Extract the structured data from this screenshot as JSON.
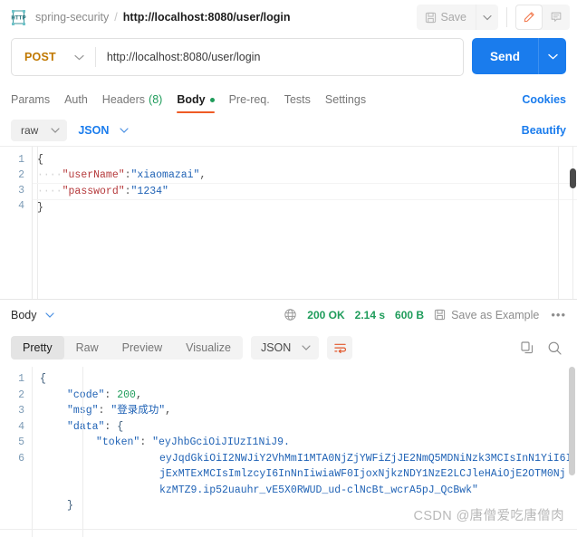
{
  "topbar": {
    "logo_icon": "http-logo-icon",
    "collection": "spring-security",
    "separator": "/",
    "request_name": "http://localhost:8080/user/login",
    "save_label": "Save",
    "save_icon": "floppy-disk-icon",
    "save_caret_icon": "chevron-down-icon",
    "edit_icon": "pencil-icon",
    "comment_icon": "comment-icon"
  },
  "request": {
    "method": "POST",
    "method_caret_icon": "chevron-down-icon",
    "url": "http://localhost:8080/user/login",
    "send_label": "Send",
    "send_caret_icon": "chevron-down-icon",
    "tabs": [
      {
        "label": "Params",
        "selected": false
      },
      {
        "label": "Auth",
        "selected": false
      },
      {
        "label": "Headers",
        "count": "(8)",
        "selected": false
      },
      {
        "label": "Body",
        "selected": true,
        "dot": true
      },
      {
        "label": "Pre-req.",
        "selected": false
      },
      {
        "label": "Tests",
        "selected": false
      },
      {
        "label": "Settings",
        "selected": false
      }
    ],
    "cookies_label": "Cookies",
    "body_mode": "raw",
    "body_mode_caret_icon": "chevron-down-icon",
    "body_format": "JSON",
    "body_format_caret_icon": "chevron-down-icon",
    "beautify_label": "Beautify",
    "body_lines": [
      {
        "n": "1",
        "open_brace": "{"
      },
      {
        "n": "2",
        "indent": "····",
        "key": "\"userName\"",
        "colon": ":",
        "value": "\"xiaomazai\"",
        "comma": ","
      },
      {
        "n": "3",
        "indent": "····",
        "key": "\"password\"",
        "colon": ":",
        "value": "\"1234\"",
        "comma": ""
      },
      {
        "n": "4",
        "close_brace": "}"
      }
    ]
  },
  "response": {
    "body_label": "Body",
    "body_caret_icon": "chevron-down-icon",
    "globe_icon": "globe-icon",
    "status_code": "200 OK",
    "time": "2.14 s",
    "size": "600 B",
    "save_example_icon": "floppy-disk-icon",
    "save_example_label": "Save as Example",
    "more_icon": "ellipsis-icon",
    "view_tabs": [
      {
        "label": "Pretty",
        "selected": true
      },
      {
        "label": "Raw",
        "selected": false
      },
      {
        "label": "Preview",
        "selected": false
      },
      {
        "label": "Visualize",
        "selected": false
      }
    ],
    "format": "JSON",
    "format_caret_icon": "chevron-down-icon",
    "wrap_icon": "word-wrap-icon",
    "copy_icon": "copy-icon",
    "search_icon": "search-icon",
    "lines": [
      {
        "n": "1",
        "text": "{"
      },
      {
        "n": "2",
        "key": "\"code\"",
        "colon": ": ",
        "num": "200",
        "comma": ","
      },
      {
        "n": "3",
        "key": "\"msg\"",
        "colon": ": ",
        "str": "\"登录成功\"",
        "comma": ","
      },
      {
        "n": "4",
        "key": "\"data\"",
        "colon": ": ",
        "brace": "{"
      },
      {
        "n": "5",
        "key": "\"token\"",
        "colon": ": ",
        "str_start": "\"eyJhbGciOiJIUzI1NiJ9."
      },
      {
        "n": "",
        "cont": "eyJqdGkiOiI2NWJiY2VhMmI1MTA0NjZjYWFiZjJE2NmQ5MDNiNzk3MCIsInN1YiI6I"
      },
      {
        "n": "",
        "cont": "jExMTExMCIsImlzcyI6InNnIiwiaWF0IjoxNjkzNDY1NzE2LCJleHAiOjE2OTM0Nj"
      },
      {
        "n": "",
        "cont": "kzMTZ9.ip52uauhr_vE5X0RWUD_ud-clNcBt_wcrA5pJ_QcBwk\""
      },
      {
        "n": "6",
        "text": "}"
      }
    ]
  },
  "watermark": "CSDN @唐僧爱吃唐僧肉"
}
